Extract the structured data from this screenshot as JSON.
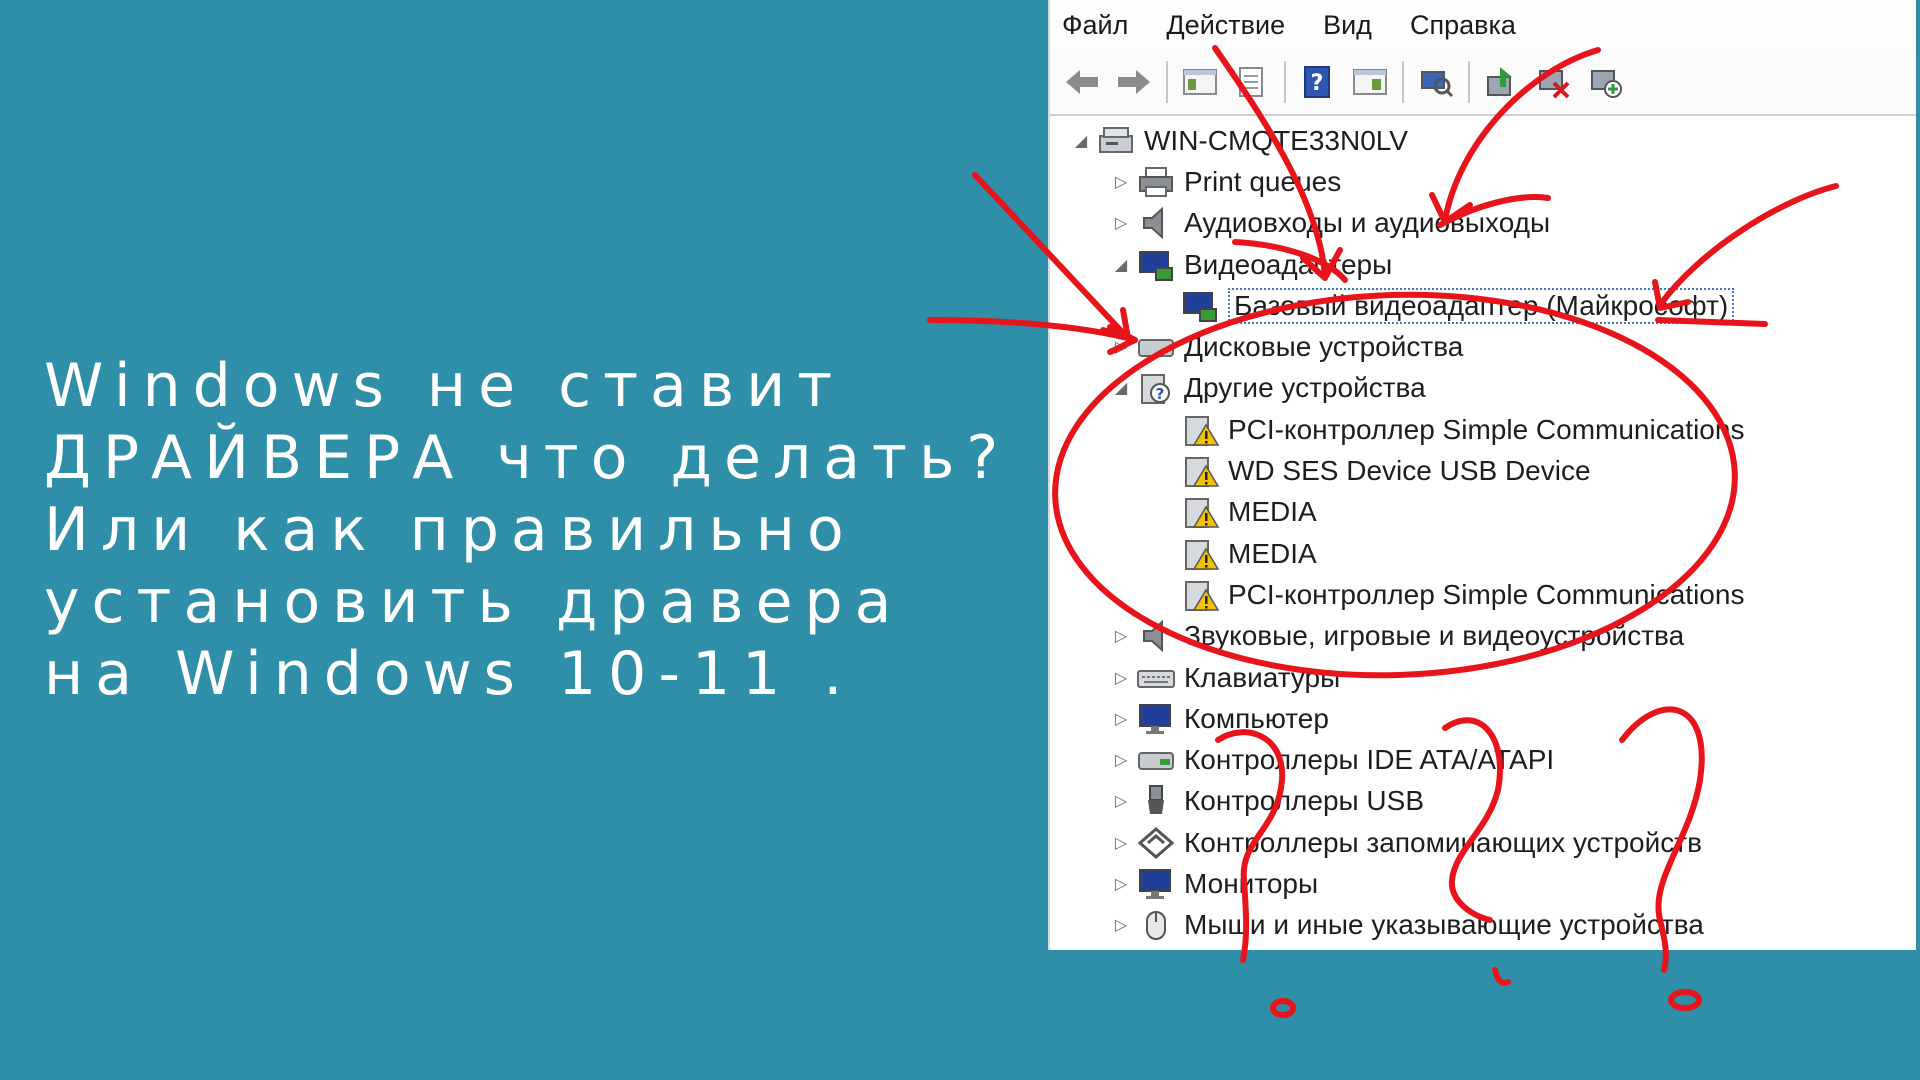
{
  "headline": {
    "lines": [
      "Windows не ставит",
      "ДРАЙВЕРА что делать?",
      "Или как правильно",
      "установить дравера",
      "на Windows 10-11 ."
    ]
  },
  "device_manager": {
    "menu": [
      "Файл",
      "Действие",
      "Вид",
      "Справка"
    ],
    "toolbar": [
      "back-icon",
      "forward-icon",
      "tree-view-icon",
      "properties-icon",
      "help-icon",
      "resources-view-icon",
      "scan-hardware-icon",
      "update-driver-icon",
      "uninstall-device-icon",
      "add-legacy-icon"
    ],
    "tree": {
      "root": "WIN-CMQTE33N0LV",
      "categories": [
        "Print queues",
        "Аудиовходы и аудиовыходы",
        "Видеоадаптеры",
        "Базовый видеоадаптер (Майкрософт)",
        "Дисковые устройства",
        "Другие устройства",
        "PCI-контроллер Simple Communications",
        "WD SES Device USB Device",
        "MEDIA",
        "MEDIA",
        "PCI-контроллер Simple Communications",
        "Звуковые, игровые и видеоустройства",
        "Клавиатуры",
        "Компьютер",
        "Контроллеры IDE ATA/ATAPI",
        "Контроллеры USB",
        "Контроллеры запоминающих устройств",
        "Мониторы",
        "Мыши и иные указывающие устройства"
      ]
    }
  },
  "colors": {
    "background": "#2f8ea8",
    "annotation": "#e8141b",
    "warning": "#f2c200"
  }
}
